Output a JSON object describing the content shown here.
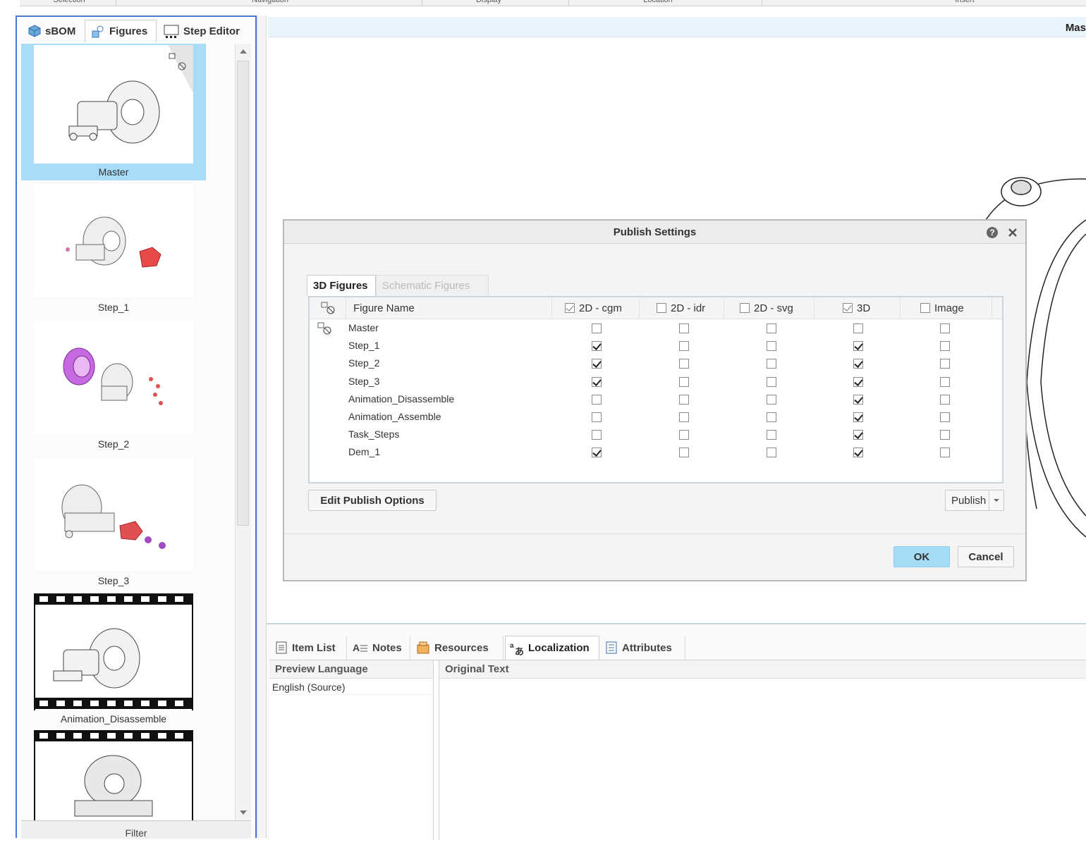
{
  "ribbon": {
    "groups": [
      "Selection",
      "Navigation",
      "Display",
      "Location",
      "Insert"
    ]
  },
  "left_panel": {
    "tabs": [
      {
        "label": "sBOM",
        "icon": "cube-icon"
      },
      {
        "label": "Figures",
        "icon": "figures-icon"
      },
      {
        "label": "Step Editor",
        "icon": "step-editor-icon"
      }
    ],
    "active_tab": "Figures",
    "thumbnails": [
      {
        "label": "Master",
        "selected": true,
        "type": "figure"
      },
      {
        "label": "Step_1",
        "selected": false,
        "type": "figure"
      },
      {
        "label": "Step_2",
        "selected": false,
        "type": "figure"
      },
      {
        "label": "Step_3",
        "selected": false,
        "type": "figure"
      },
      {
        "label": "Animation_Disassemble",
        "selected": false,
        "type": "animation"
      },
      {
        "label": "",
        "selected": false,
        "type": "animation"
      }
    ],
    "filter_label": "Filter"
  },
  "viewport": {
    "title": "Mas"
  },
  "dialog": {
    "title": "Publish Settings",
    "help_icon": "help-icon",
    "close_icon": "close-icon",
    "tabs": [
      "3D Figures",
      "Schematic Figures"
    ],
    "active_tab": "3D Figures",
    "columns": {
      "name": "Figure Name",
      "formats": [
        {
          "label": "2D - cgm",
          "header_state": "partial"
        },
        {
          "label": "2D - idr",
          "header_state": "off"
        },
        {
          "label": "2D - svg",
          "header_state": "off"
        },
        {
          "label": "3D",
          "header_state": "partial"
        },
        {
          "label": "Image",
          "header_state": "off"
        }
      ]
    },
    "rows": [
      {
        "name": "Master",
        "is_master": true,
        "values": [
          false,
          false,
          false,
          false,
          false
        ]
      },
      {
        "name": "Step_1",
        "is_master": false,
        "values": [
          true,
          false,
          false,
          true,
          false
        ]
      },
      {
        "name": "Step_2",
        "is_master": false,
        "values": [
          true,
          false,
          false,
          true,
          false
        ]
      },
      {
        "name": "Step_3",
        "is_master": false,
        "values": [
          true,
          false,
          false,
          true,
          false
        ]
      },
      {
        "name": "Animation_Disassemble",
        "is_master": false,
        "values": [
          false,
          false,
          false,
          true,
          false
        ]
      },
      {
        "name": "Animation_Assemble",
        "is_master": false,
        "values": [
          false,
          false,
          false,
          true,
          false
        ]
      },
      {
        "name": "Task_Steps",
        "is_master": false,
        "values": [
          false,
          false,
          false,
          true,
          false
        ]
      },
      {
        "name": "Dem_1",
        "is_master": false,
        "values": [
          true,
          false,
          false,
          true,
          false
        ]
      }
    ],
    "edit_button": "Edit Publish Options",
    "publish_button": "Publish",
    "ok_button": "OK",
    "cancel_button": "Cancel"
  },
  "bottom_panel": {
    "tabs": [
      {
        "label": "Item List",
        "icon": "item-list-icon"
      },
      {
        "label": "Notes",
        "icon": "notes-icon"
      },
      {
        "label": "Resources",
        "icon": "resources-icon"
      },
      {
        "label": "Localization",
        "icon": "localization-icon"
      },
      {
        "label": "Attributes",
        "icon": "attributes-icon"
      }
    ],
    "active_tab": "Localization",
    "preview_language_header": "Preview Language",
    "original_text_header": "Original Text",
    "languages": [
      "English (Source)"
    ]
  }
}
